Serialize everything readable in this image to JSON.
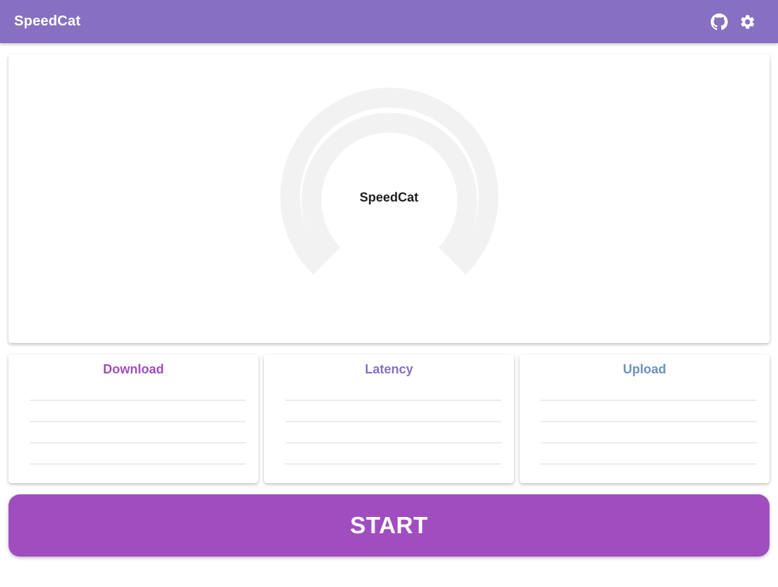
{
  "header": {
    "title": "SpeedCat",
    "icons": [
      "github-icon",
      "gear-icon"
    ]
  },
  "gauge": {
    "label": "SpeedCat"
  },
  "metrics": [
    {
      "label": "Download",
      "color": "#a04ebf"
    },
    {
      "label": "Latency",
      "color": "#8770c2"
    },
    {
      "label": "Upload",
      "color": "#6a91c4"
    }
  ],
  "start_button": {
    "label": "START"
  },
  "colors": {
    "app_bar": "#8770c2",
    "start_button": "#a04ebf",
    "gauge_track": "#f2f2f2"
  }
}
